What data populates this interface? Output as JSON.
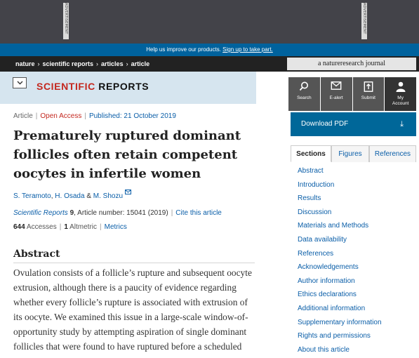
{
  "ad": {
    "tag_text": "ADVERTISEMENT"
  },
  "notice": {
    "text": "Help us improve our products.",
    "link": "Sign up to take part."
  },
  "breadcrumb": [
    "nature",
    "scientific reports",
    "articles",
    "article"
  ],
  "journal_badge": "a natureresearch journal",
  "header": {
    "logo_part1": "SCIENTIFIC",
    "logo_part2": "REPORTS"
  },
  "toolbar": {
    "search": "Search",
    "ealert": "E-alert",
    "submit": "Submit",
    "account_line1": "My",
    "account_line2": "Account"
  },
  "download": {
    "label": "Download PDF",
    "icon": "download-arrow-icon"
  },
  "article": {
    "type": "Article",
    "access": "Open Access",
    "published": "Published: 21 October 2019",
    "title_lines": [
      "Prematurely ruptured dominant",
      "follicles often retain competent",
      "oocytes in infertile women"
    ],
    "authors": [
      "S. Teramoto",
      "H. Osada",
      "M. Shozu"
    ],
    "author_sep": ",",
    "author_amp": "&",
    "journal": "Scientific Reports",
    "volume": "9",
    "article_number": ", Article number: 15041 (2019)",
    "cite_link": "Cite this article",
    "accesses_count": "644",
    "accesses_label": "Accesses",
    "altmetric_count": "1",
    "altmetric_label": "Altmetric",
    "metrics_link": "Metrics"
  },
  "abstract": {
    "heading": "Abstract",
    "lines": [
      "Ovulation consists of a follicle’s rupture and subsequent oocyte",
      "extrusion, although there is a paucity of evidence regarding",
      "whether every follicle’s rupture is associated with extrusion of",
      "its oocyte. We examined this issue in a large-scale window-of-",
      "opportunity study by attempting aspiration of single dominant",
      "follicles that were found to have ruptured before a scheduled"
    ]
  },
  "sidebar": {
    "tabs": [
      "Sections",
      "Figures",
      "References"
    ],
    "active_tab": "Sections",
    "sections": [
      "Abstract",
      "Introduction",
      "Results",
      "Discussion",
      "Materials and Methods",
      "Data availability",
      "References",
      "Acknowledgements",
      "Author information",
      "Ethics declarations",
      "Additional information",
      "Supplementary information",
      "Rights and permissions",
      "About this article"
    ]
  },
  "colors": {
    "ad_band": "#434349",
    "notice": "#00629d",
    "crumb_bar": "#222222",
    "header_bg": "#d6e5ef",
    "logo_red": "#c4281f",
    "link_blue": "#0a5ea8",
    "download_bg": "#006799"
  }
}
